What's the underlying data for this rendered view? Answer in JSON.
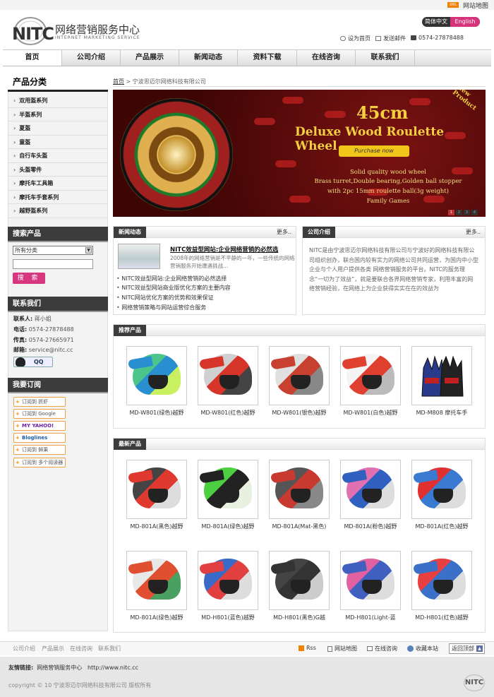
{
  "topbar": {
    "xml_badge": "XML",
    "sitemap": "网站地图"
  },
  "header": {
    "logo_text": "NITC",
    "brand_cn": "网络营销服务中心",
    "brand_en": "INTERNET MARKETING SERVICE",
    "lang_cn": "简体中文",
    "lang_en": "English",
    "set_home": "设为首页",
    "send_mail": "发送邮件",
    "phone": "0574-27878488"
  },
  "nav": [
    "首页",
    "公司介绍",
    "产品展示",
    "新闻动态",
    "资料下载",
    "在线咨询",
    "联系我们"
  ],
  "sidebar": {
    "cat_title": "产品分类",
    "categories": [
      "双用盔系列",
      "半盔系列",
      "夏盔",
      "童盔",
      "自行车头盔",
      "头盔零件",
      "摩托车工具箱",
      "摩托车手套系列",
      "越野盔系列"
    ],
    "search_title": "搜索产品",
    "select_value": "所有分类",
    "search_button": "搜 索",
    "contact_title": "联系我们",
    "contact_person_label": "联系人:",
    "contact_person": "蒋小姐",
    "tel_label": "电话:",
    "tel": "0574-27878488",
    "fax_label": "传真:",
    "fax": "0574-27665971",
    "email_label": "邮箱:",
    "email": "service@nitc.cc",
    "qq": "QQ",
    "subscribe_title": "我要订阅",
    "feeds": [
      "订阅到 抓虾",
      "订阅到 Google",
      "MY YAHOO!",
      "Bloglines",
      "订阅到 鲜果",
      "订阅到 多个阅读器"
    ]
  },
  "breadcrumb": {
    "home": "首页",
    "sep": ">",
    "current": "宁波思迈尔网络科技有限公司"
  },
  "banner": {
    "size": "45cm",
    "title": "Deluxe Wood Roulette Wheel",
    "ribbon": "Purchase now",
    "line1": "Solid quality wood wheel",
    "line2": "Brass turret,Double bearing,Golden ball stopper",
    "line3": "with 2pc 15mm roulette ball(3g weight)",
    "line4": "Family Games",
    "corner": "New Product",
    "dots": [
      "1",
      "2",
      "3",
      "4"
    ]
  },
  "news": {
    "tag": "新闻动态",
    "more": "更多..",
    "headline": "NITC效益型网站:企业网络营销的必然选",
    "summary": "2008年的网络营销是不平静的一年，一些传统的网络营销服务开始遭遇挑战...",
    "items": [
      "NITC效益型网站:企业网络营销的必然选择",
      "NITC效益型网站商业版优化方案的主要内容",
      "NITC网站优化方案的优势和效果保证",
      "网络营销策略与网站运营综合服务"
    ]
  },
  "about": {
    "tag": "公司介绍",
    "more": "更多..",
    "text": "NITC是由宁波思迈尔网络科技有限公司与宁波好的网络科技有限公司组织创办，联合国内较有实力的网络公司共同运营，为国内中小型企业与个人用户提供各类 网络营销服务的平台。NITC的服务理念“一切为了效益”，就是要联合各界网络营销专家，利用丰富的网络营销经验，在网络上为企业获得实实在在的效益为"
  },
  "recommend": {
    "tag": "推荐产品",
    "items": [
      "MD-W801(绿色)越野",
      "MD-W801(红色)越野",
      "MD-W801(银色)越野",
      "MD-W801(白色)越野",
      "MD-M808 摩托车手"
    ]
  },
  "latest": {
    "tag": "最新产品",
    "items": [
      "MD-801A(黑色)越野",
      "MD-801A(绿色)越野",
      "MD-801A(Mat-黑色)",
      "MD-801A(粉色)越野",
      "MD-801A(红色)越野",
      "MD-801A(绿色)越野",
      "MD-H801(蓝色)越野",
      "MD-H801(黑色)G越",
      "MD-H801(Light-蓝",
      "MD-H801(红色)越野"
    ]
  },
  "colors": {
    "accent": "#d6337a",
    "dark": "#3c3c3c"
  },
  "footer": {
    "links": [
      "公司介绍",
      "产品展示",
      "在线咨询",
      "联系我们"
    ],
    "rss": "Rss",
    "sitemap": "网站地图",
    "consult": "在线咨询",
    "bookmark": "收藏本站",
    "back_top": "返回顶部",
    "friend_label": "友情链接:",
    "friend_site": "网络营销服务中心",
    "friend_url": "http://www.nitc.cc",
    "copyright": "copyright © 10 宁波思迈尔网络科技有限公司 版权所有",
    "logo": "NITC"
  }
}
